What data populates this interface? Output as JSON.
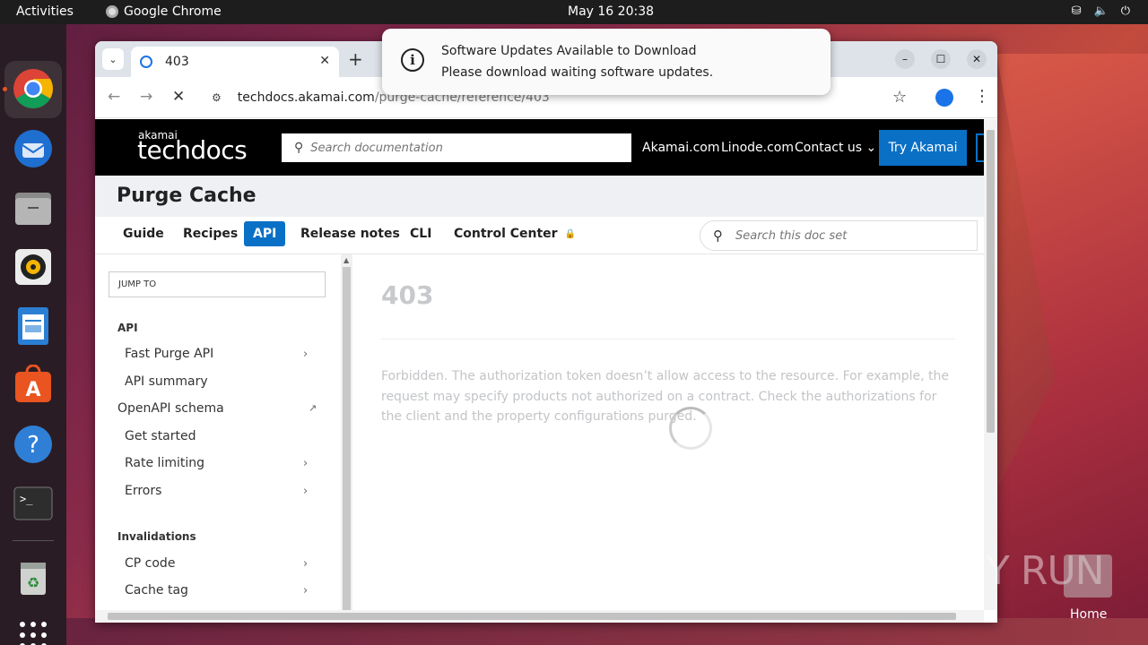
{
  "topbar": {
    "activities": "Activities",
    "app_name": "Google Chrome",
    "clock": "May 16  20:38"
  },
  "browser": {
    "tab_title": "403",
    "url_host": "techdocs.akamai.com",
    "url_path": "/purge-cache/reference/403"
  },
  "notification": {
    "title": "Software Updates Available to Download",
    "body": "Please download waiting software updates."
  },
  "site": {
    "logo_small": "akamai",
    "logo_big": "techdocs",
    "search_placeholder": "Search documentation",
    "links": [
      "Akamai.com",
      "Linode.com",
      "Contact us"
    ],
    "cta": "Try Akamai"
  },
  "doc": {
    "title": "Purge Cache",
    "tabs": [
      "Guide",
      "Recipes",
      "API",
      "Release notes",
      "CLI",
      "Control Center"
    ],
    "active_tab": "API",
    "search_placeholder": "Search this doc set"
  },
  "sidebar": {
    "jump_to": "JUMP TO",
    "section_api": "API",
    "items": [
      "Fast Purge API",
      "API summary",
      "OpenAPI schema",
      "Get started",
      "Rate limiting",
      "Errors"
    ],
    "section_invalidations": "Invalidations",
    "inv_items": [
      "CP code",
      "Cache tag"
    ]
  },
  "content": {
    "heading": "403",
    "description": "Forbidden. The authorization token doesn’t allow access to the resource. For example, the request may specify products not authorized on a contract. Check the authorizations for the client and the property configurations purged."
  },
  "desktop": {
    "watermark": "ANY RUN",
    "home_label": "Home"
  },
  "colors": {
    "accent": "#0a70c6",
    "ubuntu_orange": "#e95420"
  }
}
